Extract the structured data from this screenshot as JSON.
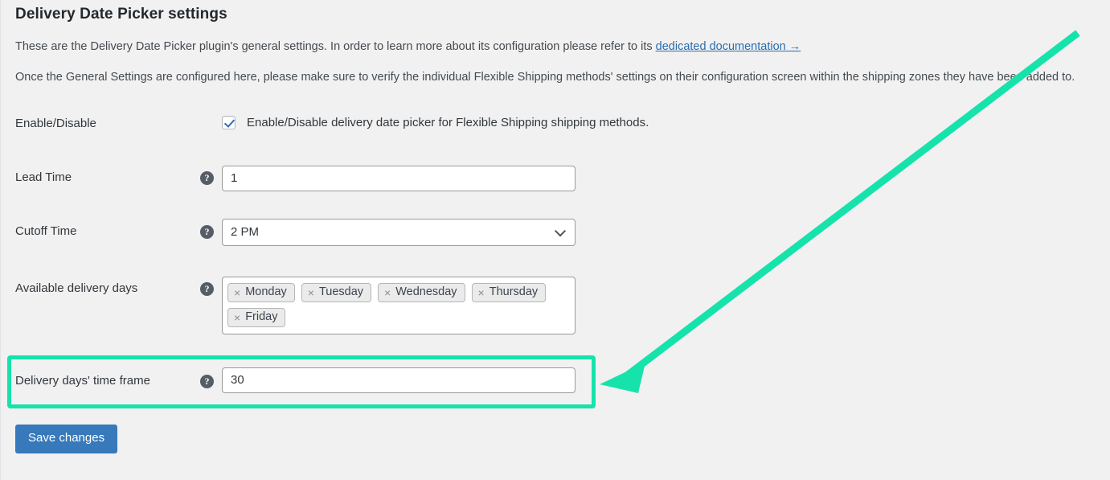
{
  "header": {
    "title": "Delivery Date Picker settings",
    "intro_1_prefix": "These are the Delivery Date Picker plugin's general settings. In order to learn more about its configuration please refer to its ",
    "intro_1_link": "dedicated documentation →",
    "intro_2": "Once the General Settings are configured here, please make sure to verify the individual Flexible Shipping methods' settings on their configuration screen within the shipping zones they have been added to."
  },
  "rows": {
    "enable_disable": {
      "label": "Enable/Disable",
      "checkbox_label": "Enable/Disable delivery date picker for Flexible Shipping shipping methods.",
      "checked": "true"
    },
    "lead_time": {
      "label": "Lead Time",
      "help": "?",
      "value": "1"
    },
    "cutoff_time": {
      "label": "Cutoff Time",
      "help": "?",
      "value": "2 PM"
    },
    "available_delivery_days": {
      "label": "Available delivery days",
      "help": "?",
      "tags": [
        {
          "remove": "×",
          "label": "Monday"
        },
        {
          "remove": "×",
          "label": "Tuesday"
        },
        {
          "remove": "×",
          "label": "Wednesday"
        },
        {
          "remove": "×",
          "label": "Thursday"
        },
        {
          "remove": "×",
          "label": "Friday"
        }
      ]
    },
    "delivery_time_frame": {
      "label": "Delivery days' time frame",
      "help": "?",
      "value": "30"
    }
  },
  "actions": {
    "save_label": "Save changes"
  },
  "annotation": {
    "highlight_color": "#15e3ab",
    "arrow_color": "#15e3ab"
  },
  "colors": {
    "page_background": "#f1f1f1",
    "accent_button": "#3779ba",
    "link": "#2b6cb0",
    "checkbox_check": "#2a6fb6"
  }
}
